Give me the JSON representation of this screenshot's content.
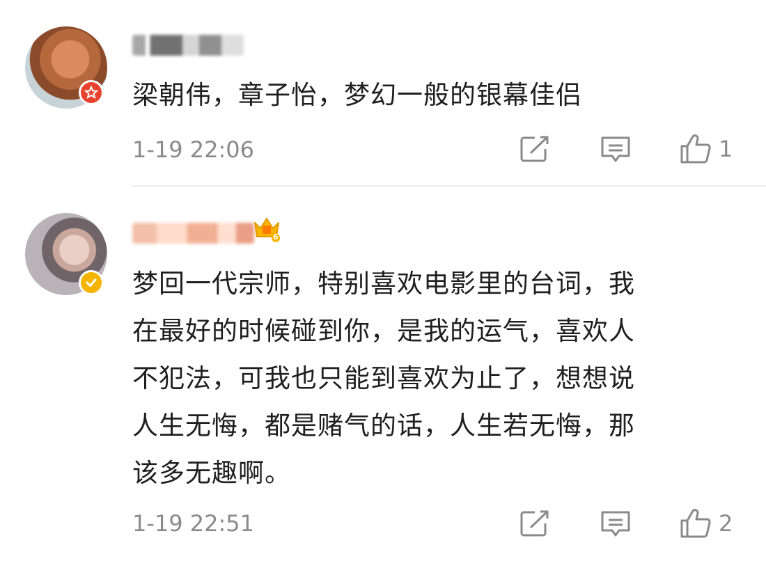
{
  "comments": [
    {
      "author_label": "",
      "badge_icon": "star-badge-icon",
      "text": "梁朝伟，章子怡，梦幻一般的银幕佳侣",
      "time": "1-19 22:06",
      "share_icon": "share-icon",
      "reply_icon": "comment-icon",
      "like_icon": "thumbs-up-icon",
      "likes": "1"
    },
    {
      "author_label": "",
      "badge_icon": "verified-check-icon",
      "level_badge": "6",
      "text": "梦回一代宗师，特别喜欢电影里的台词，我\n在最好的时候碰到你，是我的运气，喜欢人\n不犯法，可我也只能到喜欢为止了，想想说\n人生无悔，都是赌气的话，人生若无悔，那\n该多无趣啊。",
      "time": "1-19 22:51",
      "share_icon": "share-icon",
      "reply_icon": "comment-icon",
      "like_icon": "thumbs-up-icon",
      "likes": "2"
    }
  ],
  "colors": {
    "text": "#1f1f1f",
    "meta": "#8a8a8a",
    "badge_red": "#e8432f",
    "badge_gold": "#f5b400",
    "divider": "#ececec"
  }
}
